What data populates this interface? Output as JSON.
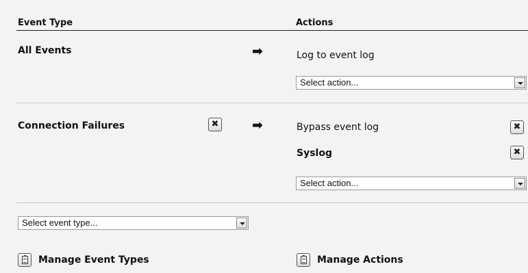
{
  "header": {
    "event_type": "Event Type",
    "actions": "Actions"
  },
  "rules": [
    {
      "event": "All Events",
      "arrow_icon": "right-arrow-icon",
      "actions": [
        "Log to event log"
      ],
      "select_placeholder": "Select action..."
    },
    {
      "event": "Connection Failures",
      "arrow_icon": "right-arrow-icon",
      "remove_icon": "✖",
      "actions": [
        "Bypass event log",
        "Syslog"
      ],
      "select_placeholder": "Select action..."
    }
  ],
  "event_type_select": {
    "placeholder": "Select event type..."
  },
  "manage": {
    "event_types_label": "Manage Event Types",
    "actions_label": "Manage Actions"
  }
}
